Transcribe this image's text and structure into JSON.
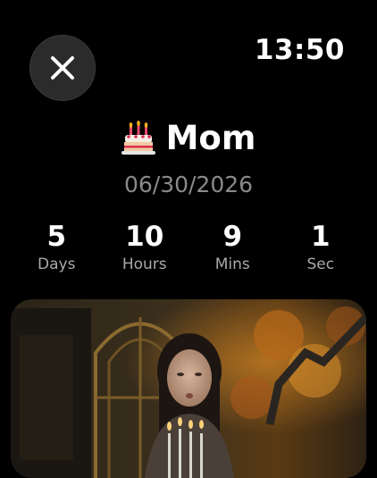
{
  "header": {
    "clock": "13:50"
  },
  "event": {
    "emoji": "cake-icon",
    "title": "Mom",
    "date": "06/30/2026"
  },
  "countdown": [
    {
      "value": "5",
      "label": "Days"
    },
    {
      "value": "10",
      "label": "Hours"
    },
    {
      "value": "9",
      "label": "Mins"
    },
    {
      "value": "1",
      "label": "Sec"
    }
  ],
  "photo": {
    "subject": "woman-blowing-candles"
  }
}
